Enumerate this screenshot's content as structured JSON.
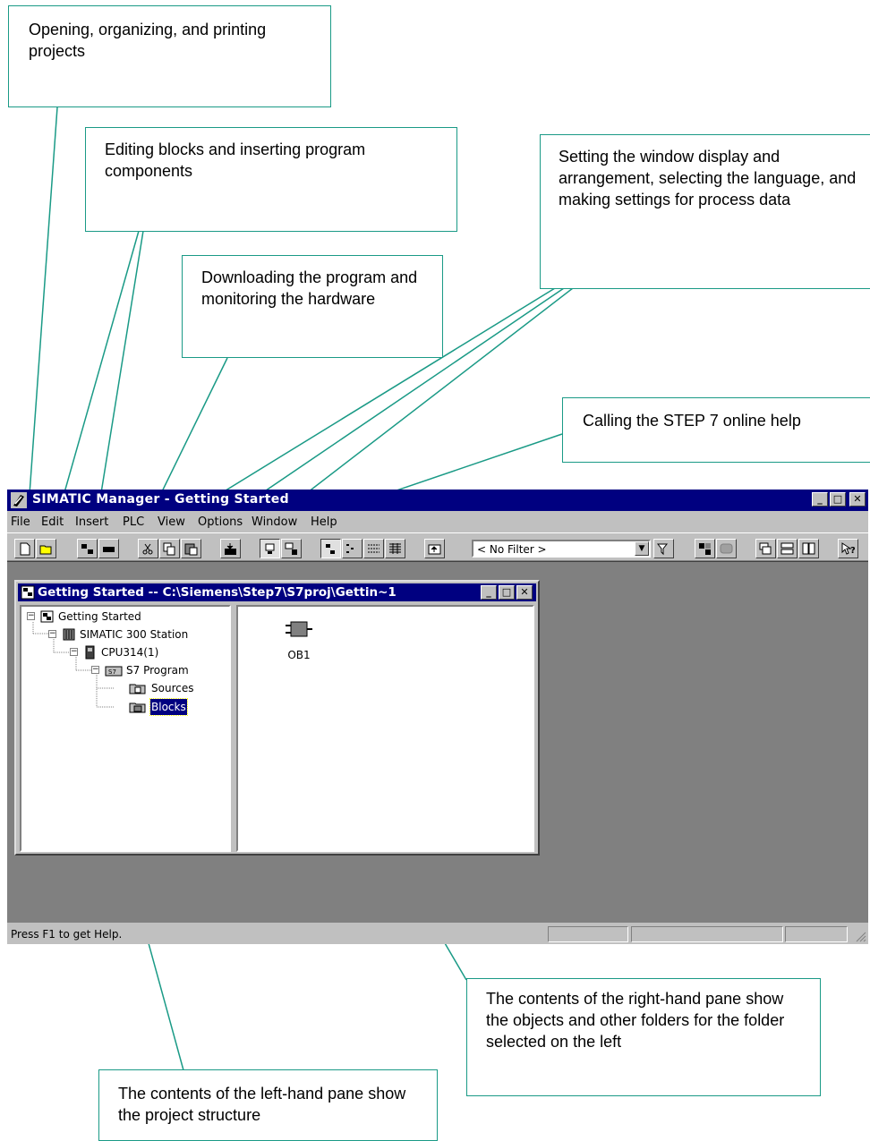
{
  "callouts": {
    "file_menu": "Opening, organizing, and printing projects",
    "edit_insert": "Editing blocks and inserting program components",
    "plc_menu": "Downloading the program and monitoring the hardware",
    "view_options_window": "Setting the window display and arrangement, selecting the language, and making settings for process data",
    "help_menu": "Calling the STEP 7 online help",
    "right_pane": "The contents of the right-hand pane show the objects and other folders for the folder selected on the left",
    "left_pane": "The contents of the left-hand pane show the project structure"
  },
  "window": {
    "title": "SIMATIC Manager - Getting Started",
    "controls": {
      "minimize": "_",
      "maximize": "□",
      "close": "✕"
    }
  },
  "menu": [
    "File",
    "Edit",
    "Insert",
    "PLC",
    "View",
    "Options",
    "Window",
    "Help"
  ],
  "toolbar": {
    "filter_value": "< No Filter >",
    "icons": [
      "new-icon",
      "open-icon",
      "accessible-nodes-icon",
      "memory-card-icon",
      "cut-icon",
      "copy-icon",
      "paste-icon",
      "download-icon",
      "offline-icon",
      "online-icon",
      "large-icons-icon",
      "small-icons-icon",
      "list-icon",
      "details-icon",
      "up-one-level-icon",
      "filter-icon",
      "simatic-manager-icon",
      "display-icon",
      "cascade-icon",
      "tile-horizontal-icon",
      "tile-vertical-icon",
      "context-help-icon"
    ]
  },
  "project_window": {
    "title": "Getting Started -- C:\\Siemens\\Step7\\S7proj\\Gettin~1",
    "tree": [
      {
        "label": "Getting Started",
        "icon": "project-icon",
        "level": 0
      },
      {
        "label": "SIMATIC 300 Station",
        "icon": "station-icon",
        "level": 1
      },
      {
        "label": "CPU314(1)",
        "icon": "cpu-icon",
        "level": 2
      },
      {
        "label": "S7 Program",
        "icon": "s7-program-icon",
        "level": 3
      },
      {
        "label": "Sources",
        "icon": "sources-folder-icon",
        "level": 4
      },
      {
        "label": "Blocks",
        "icon": "blocks-folder-icon",
        "level": 4,
        "selected": true
      }
    ],
    "objects": [
      {
        "label": "OB1",
        "icon": "organization-block-icon"
      }
    ]
  },
  "statusbar": {
    "text": "Press F1 to get Help."
  },
  "colors": {
    "callout_border": "#1a9a86",
    "title_bar": "#000080",
    "window_face": "#c0c0c0",
    "mdi_background": "#808080"
  }
}
